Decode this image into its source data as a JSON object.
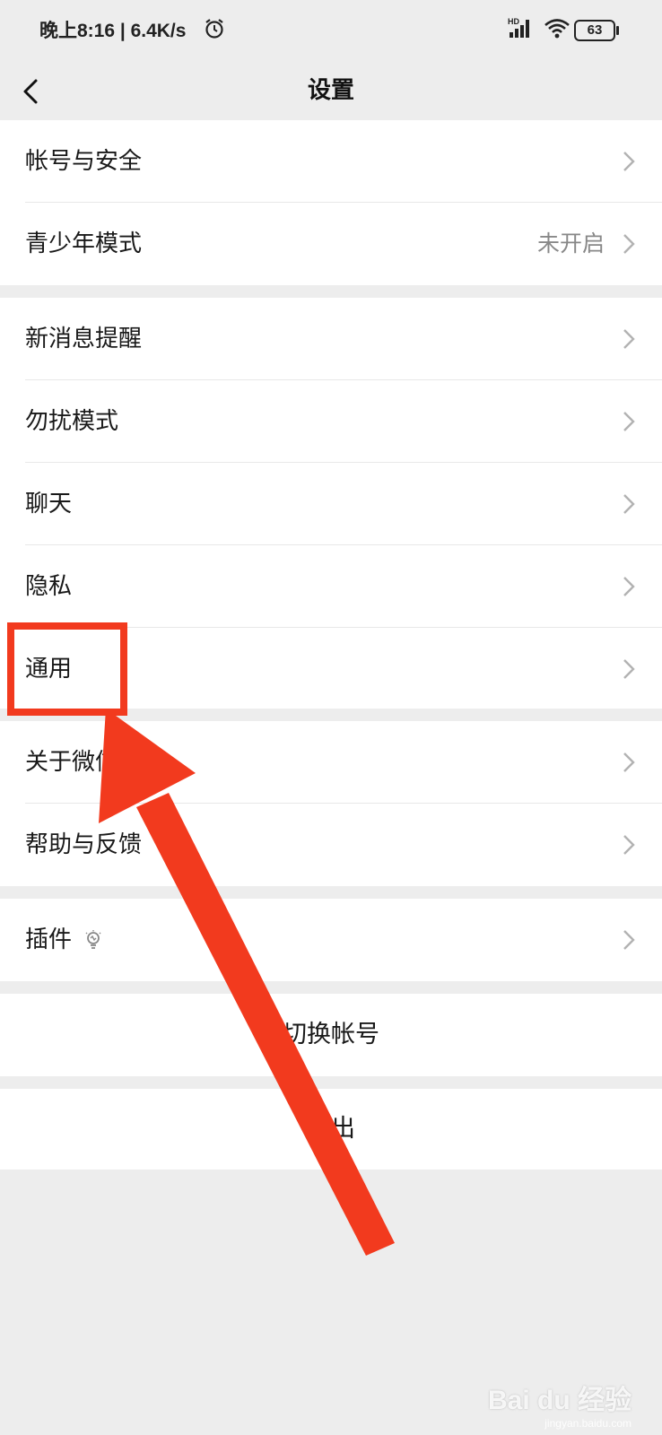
{
  "status_bar": {
    "time_speed": "晚上8:16 | 6.4K/s",
    "battery": "63",
    "icons": [
      "alarm-icon",
      "signal-hd-icon",
      "wifi-icon",
      "battery-icon"
    ]
  },
  "header": {
    "title": "设置",
    "back_icon": "chevron-left-icon"
  },
  "settings": {
    "group1": [
      {
        "label": "帐号与安全",
        "value": ""
      },
      {
        "label": "青少年模式",
        "value": "未开启"
      }
    ],
    "group2": [
      {
        "label": "新消息提醒"
      },
      {
        "label": "勿扰模式"
      },
      {
        "label": "聊天"
      },
      {
        "label": "隐私"
      },
      {
        "label": "通用"
      }
    ],
    "group3": [
      {
        "label": "关于微信"
      },
      {
        "label": "帮助与反馈"
      }
    ],
    "group4": [
      {
        "label": "插件",
        "icon": "bulb-icon"
      }
    ],
    "switch_account": "切换帐号",
    "logout": "退出"
  },
  "annotation": {
    "highlight_color": "#f23a1e",
    "highlighted_item": "通用"
  },
  "watermark": {
    "text": "Bai du 经验",
    "sub": "jingyan.baidu.com"
  }
}
